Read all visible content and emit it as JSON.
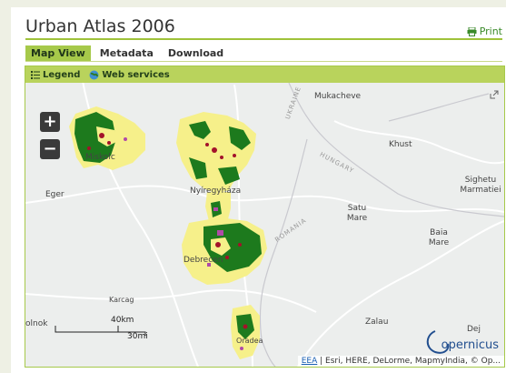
{
  "header": {
    "title": "Urban Atlas 2006",
    "print_label": "Print"
  },
  "tabs": [
    {
      "label": "Map View",
      "active": true
    },
    {
      "label": "Metadata",
      "active": false
    },
    {
      "label": "Download",
      "active": false
    }
  ],
  "map_toolbar": {
    "legend_label": "Legend",
    "web_services_label": "Web services"
  },
  "zoom": {
    "in_label": "+",
    "out_label": "−"
  },
  "places": {
    "mukacheve": "Mukacheve",
    "khust": "Khust",
    "eger": "Eger",
    "miskolc": "Miskolc",
    "nyiregyhaza": "Nyíregyháza",
    "satu_mare": "Satu Mare",
    "sighetu": "Sighetu Marmatiei",
    "baia_mare": "Baia Mare",
    "debrecen": "Debrecen",
    "karcag": "Karcag",
    "zalau": "Zalau",
    "dej": "Dej",
    "olnok": "olnok",
    "oradea": "Oradea"
  },
  "borders": {
    "ukraine": "UKRAINE",
    "hungary": "HUNGARY",
    "romania": "ROMANIA"
  },
  "scale": {
    "km": "40km",
    "mi": "30mi"
  },
  "attribution": {
    "link": "EEA",
    "text": "| Esri, HERE, DeLorme, MapmyIndia, © Op..."
  },
  "logo": "opernicus",
  "colors": {
    "accent": "#a6c94a",
    "urban_green": "#1d7a1d",
    "urban_yellow": "#f6f08a",
    "urban_red": "#a3122a",
    "urban_purple": "#b04aa8"
  }
}
